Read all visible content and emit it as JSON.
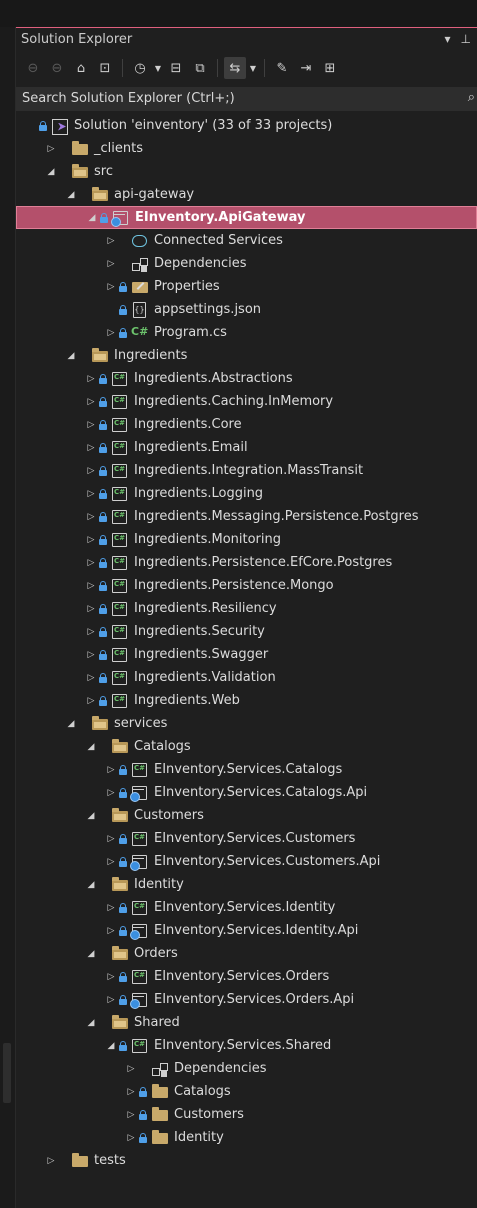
{
  "panel": {
    "title": "Solution Explorer",
    "pin_glyph": "⊥",
    "menu_glyph": "▾"
  },
  "toolbar": {
    "back_icon": "back-icon",
    "forward_icon": "forward-icon",
    "home_icon": "home-icon",
    "switch_views_icon": "switch-views-icon",
    "pending_changes_icon": "clock-icon",
    "collapse_all_icon": "collapse-all-icon",
    "show_all_files_icon": "show-all-files-icon",
    "sync_icon": "sync-with-active-document-icon",
    "properties_icon": "wrench-icon",
    "preview_icon": "preview-selected-items-icon",
    "class_view_icon": "class-view-icon"
  },
  "search": {
    "placeholder": "Search Solution Explorer (Ctrl+;)"
  },
  "colors": {
    "accent": "#b4506b",
    "accent_border": "#e07f97",
    "lock": "#4f9fe8",
    "folder": "#c8a96a",
    "csharp": "#6cc26c"
  },
  "tree": [
    {
      "label": "Solution 'einventory' (33 of 33 projects)",
      "indent": 0,
      "arrow": "none",
      "lock": true,
      "icon": "solution"
    },
    {
      "label": "_clients",
      "indent": 1,
      "arrow": "collapsed",
      "lock": false,
      "icon": "folder"
    },
    {
      "label": "src",
      "indent": 1,
      "arrow": "expanded",
      "lock": false,
      "icon": "folder-open"
    },
    {
      "label": "api-gateway",
      "indent": 2,
      "arrow": "expanded",
      "lock": false,
      "icon": "folder-open"
    },
    {
      "label": "EInventory.ApiGateway",
      "indent": 3,
      "arrow": "expanded",
      "lock": true,
      "icon": "web-project",
      "selected": true
    },
    {
      "label": "Connected Services",
      "indent": 4,
      "arrow": "collapsed",
      "lock": false,
      "icon": "cloud"
    },
    {
      "label": "Dependencies",
      "indent": 4,
      "arrow": "collapsed",
      "lock": false,
      "icon": "dependencies"
    },
    {
      "label": "Properties",
      "indent": 4,
      "arrow": "collapsed",
      "lock": true,
      "icon": "properties"
    },
    {
      "label": "appsettings.json",
      "indent": 4,
      "arrow": "none",
      "lock": true,
      "icon": "json"
    },
    {
      "label": "Program.cs",
      "indent": 4,
      "arrow": "collapsed",
      "lock": true,
      "icon": "csfile"
    },
    {
      "label": "Ingredients",
      "indent": 2,
      "arrow": "expanded",
      "lock": false,
      "icon": "folder-open"
    },
    {
      "label": "Ingredients.Abstractions",
      "indent": 3,
      "arrow": "collapsed",
      "lock": true,
      "icon": "cs-project"
    },
    {
      "label": "Ingredients.Caching.InMemory",
      "indent": 3,
      "arrow": "collapsed",
      "lock": true,
      "icon": "cs-project"
    },
    {
      "label": "Ingredients.Core",
      "indent": 3,
      "arrow": "collapsed",
      "lock": true,
      "icon": "cs-project"
    },
    {
      "label": "Ingredients.Email",
      "indent": 3,
      "arrow": "collapsed",
      "lock": true,
      "icon": "cs-project"
    },
    {
      "label": "Ingredients.Integration.MassTransit",
      "indent": 3,
      "arrow": "collapsed",
      "lock": true,
      "icon": "cs-project"
    },
    {
      "label": "Ingredients.Logging",
      "indent": 3,
      "arrow": "collapsed",
      "lock": true,
      "icon": "cs-project"
    },
    {
      "label": "Ingredients.Messaging.Persistence.Postgres",
      "indent": 3,
      "arrow": "collapsed",
      "lock": true,
      "icon": "cs-project"
    },
    {
      "label": "Ingredients.Monitoring",
      "indent": 3,
      "arrow": "collapsed",
      "lock": true,
      "icon": "cs-project"
    },
    {
      "label": "Ingredients.Persistence.EfCore.Postgres",
      "indent": 3,
      "arrow": "collapsed",
      "lock": true,
      "icon": "cs-project"
    },
    {
      "label": "Ingredients.Persistence.Mongo",
      "indent": 3,
      "arrow": "collapsed",
      "lock": true,
      "icon": "cs-project"
    },
    {
      "label": "Ingredients.Resiliency",
      "indent": 3,
      "arrow": "collapsed",
      "lock": true,
      "icon": "cs-project"
    },
    {
      "label": "Ingredients.Security",
      "indent": 3,
      "arrow": "collapsed",
      "lock": true,
      "icon": "cs-project"
    },
    {
      "label": "Ingredients.Swagger",
      "indent": 3,
      "arrow": "collapsed",
      "lock": true,
      "icon": "cs-project"
    },
    {
      "label": "Ingredients.Validation",
      "indent": 3,
      "arrow": "collapsed",
      "lock": true,
      "icon": "cs-project"
    },
    {
      "label": "Ingredients.Web",
      "indent": 3,
      "arrow": "collapsed",
      "lock": true,
      "icon": "cs-project"
    },
    {
      "label": "services",
      "indent": 2,
      "arrow": "expanded",
      "lock": false,
      "icon": "folder-open"
    },
    {
      "label": "Catalogs",
      "indent": 3,
      "arrow": "expanded",
      "lock": false,
      "icon": "folder-open"
    },
    {
      "label": "EInventory.Services.Catalogs",
      "indent": 4,
      "arrow": "collapsed",
      "lock": true,
      "icon": "cs-project"
    },
    {
      "label": "EInventory.Services.Catalogs.Api",
      "indent": 4,
      "arrow": "collapsed",
      "lock": true,
      "icon": "web-project"
    },
    {
      "label": "Customers",
      "indent": 3,
      "arrow": "expanded",
      "lock": false,
      "icon": "folder-open"
    },
    {
      "label": "EInventory.Services.Customers",
      "indent": 4,
      "arrow": "collapsed",
      "lock": true,
      "icon": "cs-project"
    },
    {
      "label": "EInventory.Services.Customers.Api",
      "indent": 4,
      "arrow": "collapsed",
      "lock": true,
      "icon": "web-project"
    },
    {
      "label": "Identity",
      "indent": 3,
      "arrow": "expanded",
      "lock": false,
      "icon": "folder-open"
    },
    {
      "label": "EInventory.Services.Identity",
      "indent": 4,
      "arrow": "collapsed",
      "lock": true,
      "icon": "cs-project"
    },
    {
      "label": "EInventory.Services.Identity.Api",
      "indent": 4,
      "arrow": "collapsed",
      "lock": true,
      "icon": "web-project"
    },
    {
      "label": "Orders",
      "indent": 3,
      "arrow": "expanded",
      "lock": false,
      "icon": "folder-open"
    },
    {
      "label": "EInventory.Services.Orders",
      "indent": 4,
      "arrow": "collapsed",
      "lock": true,
      "icon": "cs-project"
    },
    {
      "label": "EInventory.Services.Orders.Api",
      "indent": 4,
      "arrow": "collapsed",
      "lock": true,
      "icon": "web-project"
    },
    {
      "label": "Shared",
      "indent": 3,
      "arrow": "expanded",
      "lock": false,
      "icon": "folder-open"
    },
    {
      "label": "EInventory.Services.Shared",
      "indent": 4,
      "arrow": "expanded",
      "lock": true,
      "icon": "cs-project"
    },
    {
      "label": "Dependencies",
      "indent": 5,
      "arrow": "collapsed",
      "lock": false,
      "icon": "dependencies"
    },
    {
      "label": "Catalogs",
      "indent": 5,
      "arrow": "collapsed",
      "lock": true,
      "icon": "folder"
    },
    {
      "label": "Customers",
      "indent": 5,
      "arrow": "collapsed",
      "lock": true,
      "icon": "folder"
    },
    {
      "label": "Identity",
      "indent": 5,
      "arrow": "collapsed",
      "lock": true,
      "icon": "folder"
    },
    {
      "label": "tests",
      "indent": 1,
      "arrow": "collapsed",
      "lock": false,
      "icon": "folder"
    }
  ]
}
